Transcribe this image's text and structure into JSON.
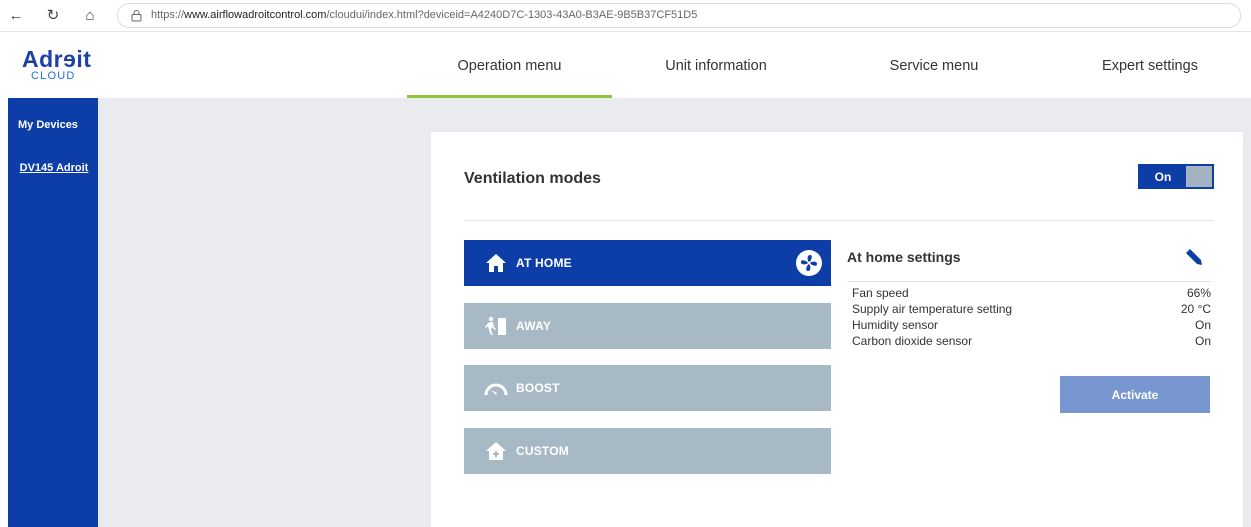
{
  "browser": {
    "url_prefix": "https://",
    "url_host": "www.airflowadroitcontrol.com",
    "url_path": "/cloudui/index.html?deviceid=A4240D7C-1303-43A0-B3AE-9B5B37CF51D5"
  },
  "logo": {
    "main": "Adrɘit",
    "sub": "CLOUD"
  },
  "tabs": [
    {
      "label": "Operation menu",
      "active": true
    },
    {
      "label": "Unit information",
      "active": false
    },
    {
      "label": "Service menu",
      "active": false
    },
    {
      "label": "Expert settings",
      "active": false
    }
  ],
  "sidebar": {
    "title": "My Devices",
    "device": "DV145 Adroit"
  },
  "ventilation": {
    "title": "Ventilation modes",
    "toggle_label": "On",
    "modes": [
      {
        "label": "AT HOME",
        "icon": "home-icon",
        "active": true
      },
      {
        "label": "AWAY",
        "icon": "away-icon",
        "active": false
      },
      {
        "label": "BOOST",
        "icon": "boost-icon",
        "active": false
      },
      {
        "label": "CUSTOM",
        "icon": "custom-home-icon",
        "active": false
      }
    ]
  },
  "settings": {
    "title": "At home settings",
    "rows": [
      {
        "key": "Fan speed",
        "value": "66%"
      },
      {
        "key": "Supply air temperature setting",
        "value": "20 °C"
      },
      {
        "key": "Humidity sensor",
        "value": "On"
      },
      {
        "key": "Carbon dioxide sensor",
        "value": "On"
      }
    ],
    "activate_label": "Activate"
  },
  "colors": {
    "brand": "#0d3ea8",
    "accent": "#8cc63f",
    "inactive_mode": "#a7b9c4",
    "activate": "#7896cf"
  }
}
